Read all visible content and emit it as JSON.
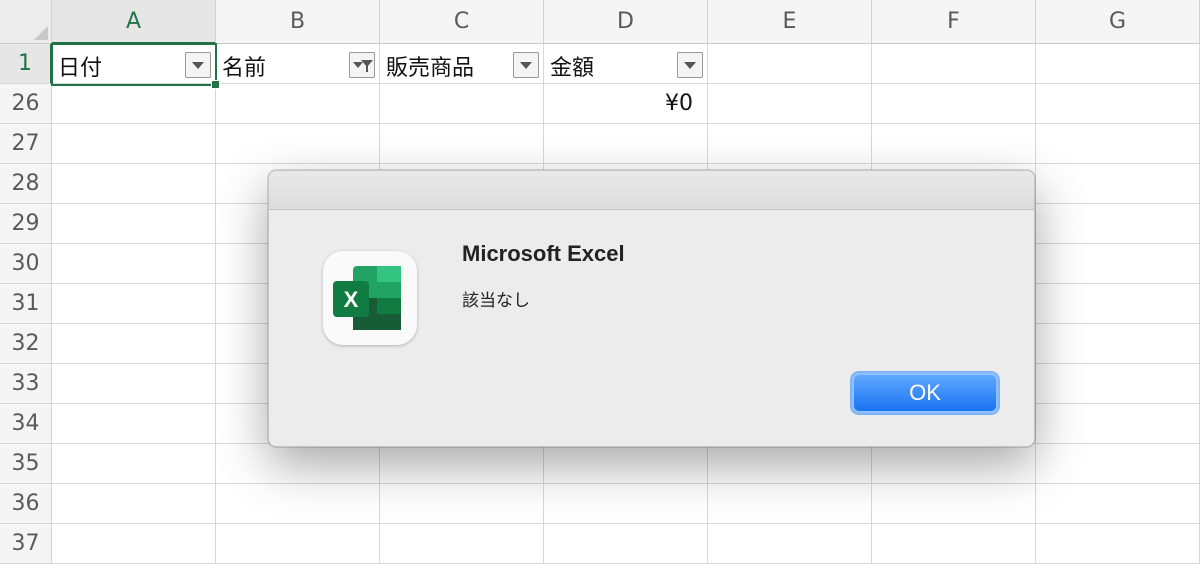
{
  "columns": [
    "A",
    "B",
    "C",
    "D",
    "E",
    "F",
    "G"
  ],
  "rows": [
    "1",
    "26",
    "27",
    "28",
    "29",
    "30",
    "31",
    "32",
    "33",
    "34",
    "35",
    "36",
    "37"
  ],
  "header_row": {
    "A": "日付",
    "B": "名前",
    "C": "販売商品",
    "D": "金額"
  },
  "row26": {
    "D": "¥0"
  },
  "dialog": {
    "title": "Microsoft Excel",
    "message": "該当なし",
    "ok_label": "OK",
    "icon_letter": "X"
  },
  "colors": {
    "excel_green": "#217346",
    "ok_blue": "#1a73f0"
  }
}
